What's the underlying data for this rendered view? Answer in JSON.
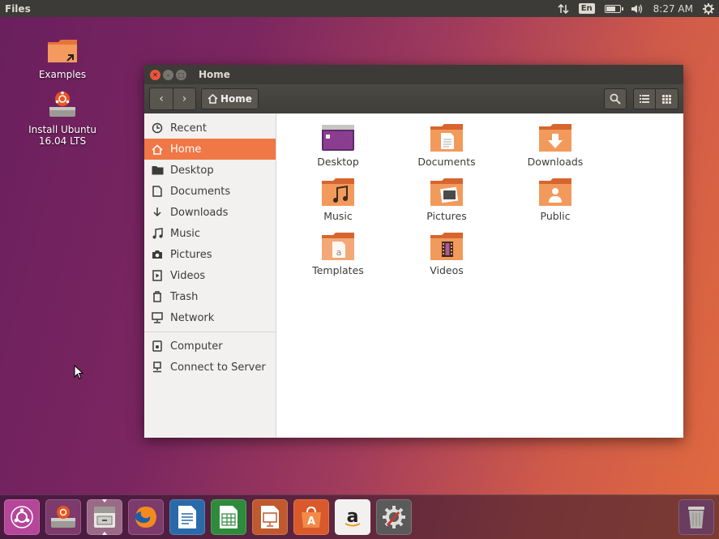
{
  "top_panel": {
    "app_name": "Files",
    "keyboard_layout": "En",
    "clock": "8:27 AM",
    "battery_level_percent": 70
  },
  "desktop_icons": [
    {
      "label": "Examples"
    },
    {
      "label": "Install Ubuntu 16.04 LTS"
    }
  ],
  "window": {
    "title": "Home",
    "path_label": "Home"
  },
  "sidebar": {
    "items": [
      {
        "label": "Recent",
        "icon": "clock-icon"
      },
      {
        "label": "Home",
        "icon": "home-icon",
        "active": true
      },
      {
        "label": "Desktop",
        "icon": "folder-icon"
      },
      {
        "label": "Documents",
        "icon": "document-icon"
      },
      {
        "label": "Downloads",
        "icon": "download-icon"
      },
      {
        "label": "Music",
        "icon": "music-icon"
      },
      {
        "label": "Pictures",
        "icon": "camera-icon"
      },
      {
        "label": "Videos",
        "icon": "video-icon"
      },
      {
        "label": "Trash",
        "icon": "trash-icon"
      },
      {
        "label": "Network",
        "icon": "network-icon"
      }
    ],
    "devices": [
      {
        "label": "Computer",
        "icon": "computer-icon"
      },
      {
        "label": "Connect to Server",
        "icon": "server-icon"
      }
    ]
  },
  "files": [
    {
      "label": "Desktop"
    },
    {
      "label": "Documents"
    },
    {
      "label": "Downloads"
    },
    {
      "label": "Music"
    },
    {
      "label": "Pictures"
    },
    {
      "label": "Public"
    },
    {
      "label": "Templates"
    },
    {
      "label": "Videos"
    }
  ],
  "launcher": [
    {
      "name": "ubuntu-dash",
      "icon": "ubuntu-logo-icon"
    },
    {
      "name": "install-ubuntu",
      "icon": "installer-icon"
    },
    {
      "name": "files",
      "icon": "file-cabinet-icon",
      "running": true
    },
    {
      "name": "firefox",
      "icon": "firefox-icon"
    },
    {
      "name": "libreoffice-writer",
      "icon": "writer-icon"
    },
    {
      "name": "libreoffice-calc",
      "icon": "calc-icon"
    },
    {
      "name": "libreoffice-impress",
      "icon": "impress-icon"
    },
    {
      "name": "ubuntu-software",
      "icon": "software-center-icon"
    },
    {
      "name": "amazon",
      "icon": "amazon-icon"
    },
    {
      "name": "system-settings",
      "icon": "settings-icon"
    },
    {
      "name": "trash",
      "icon": "trash-can-icon"
    }
  ],
  "colors": {
    "accent": "#f07746",
    "panel": "#3c3b37",
    "folder": "#e7733d"
  }
}
